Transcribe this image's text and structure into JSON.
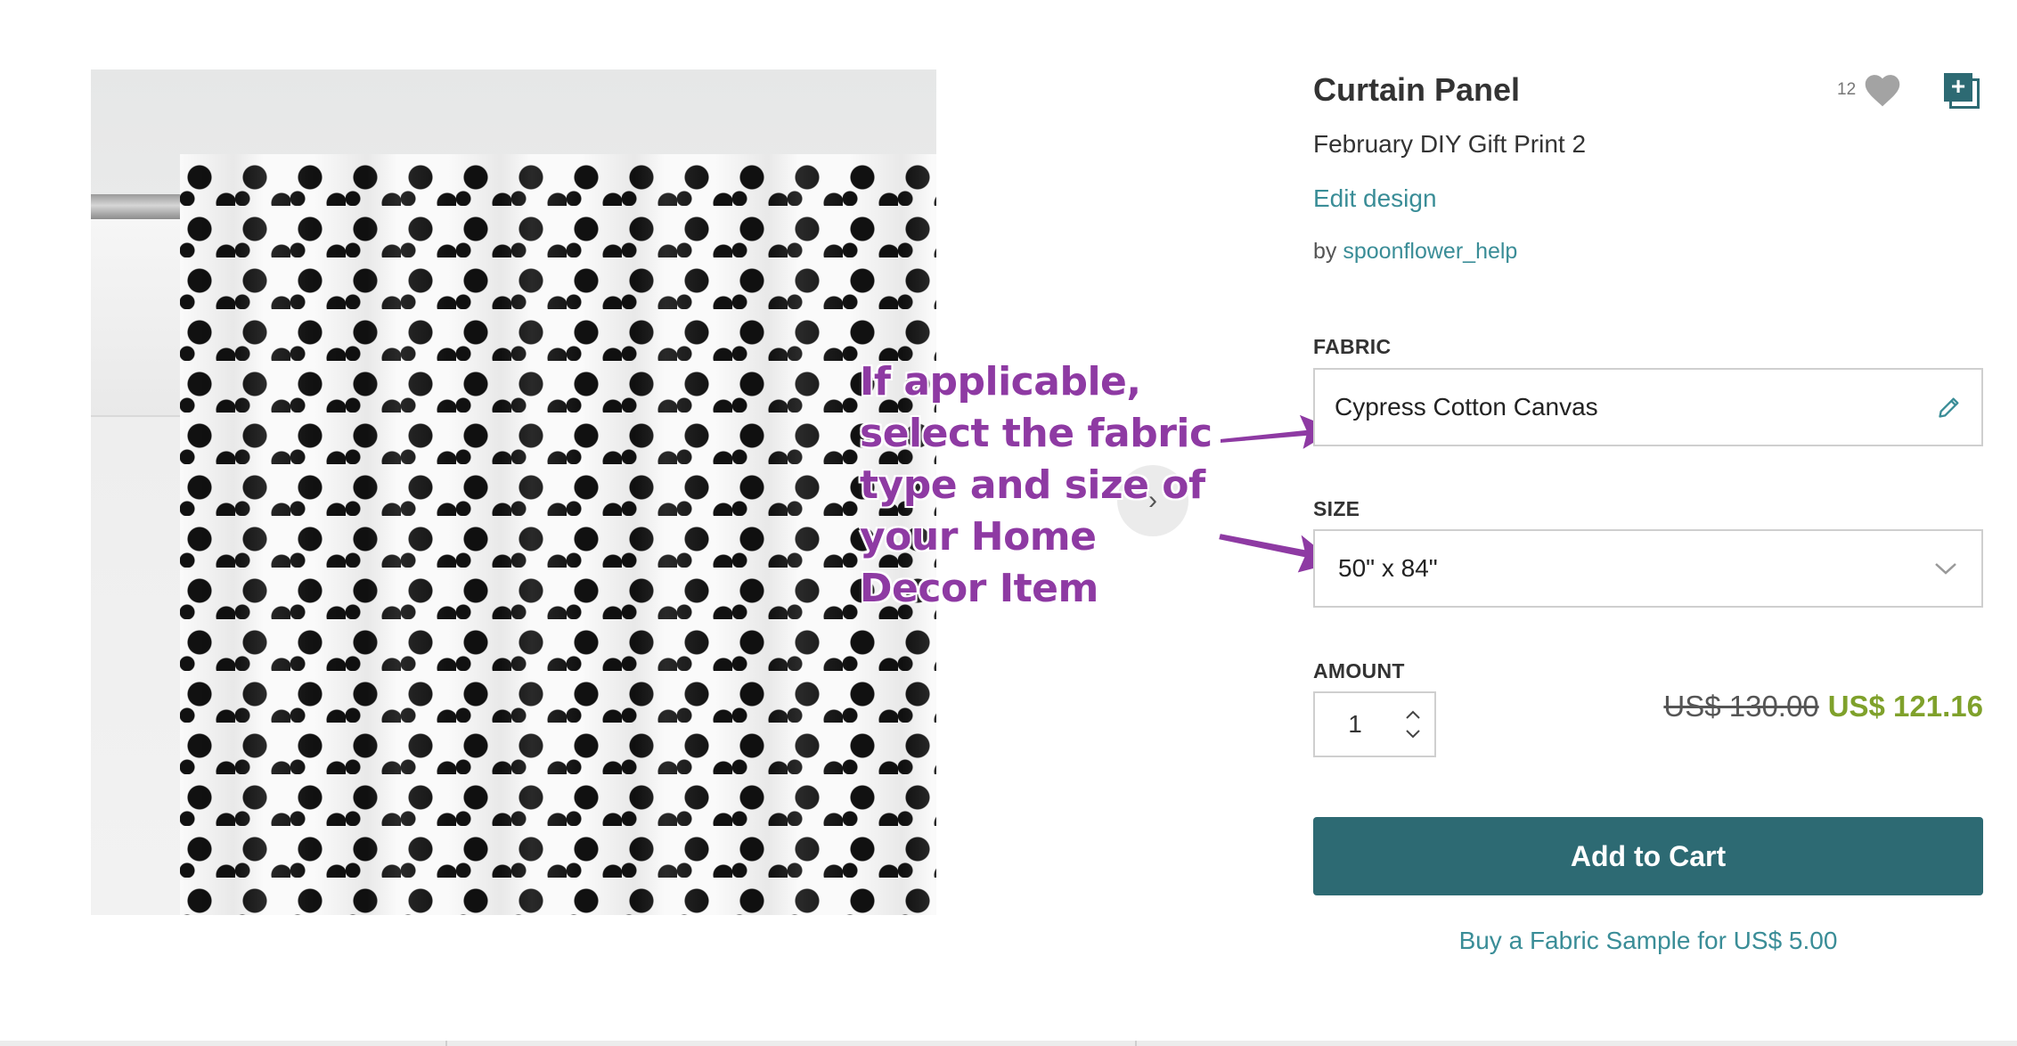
{
  "product": {
    "title": "Curtain Panel",
    "design_name": "February DIY Gift Print 2",
    "edit_design_label": "Edit design",
    "by_label": "by",
    "designer": "spoonflower_help",
    "favorite_count": "12"
  },
  "options": {
    "fabric_label": "FABRIC",
    "fabric_value": "Cypress Cotton Canvas",
    "size_label": "SIZE",
    "size_value": "50\" x 84\"",
    "amount_label": "AMOUNT",
    "amount_value": "1"
  },
  "pricing": {
    "original_price": "US$ 130.00",
    "sale_price": "US$ 121.16"
  },
  "actions": {
    "add_to_cart_label": "Add to Cart",
    "sample_link_label": "Buy a Fabric Sample for US$ 5.00"
  },
  "annotation": {
    "text": "If applicable, select the fabric type and size of your Home Decor Item",
    "color": "#8e3aa3"
  },
  "colors": {
    "brand_teal": "#2d6a73",
    "link_teal": "#3a8d97",
    "sale_green": "#7fa12b"
  },
  "icons": {
    "favorite": "heart-icon",
    "collection": "add-to-collection-icon",
    "fabric_edit": "pencil-icon",
    "size_dropdown": "chevron-down-icon",
    "carousel_next": "chevron-right-icon"
  }
}
